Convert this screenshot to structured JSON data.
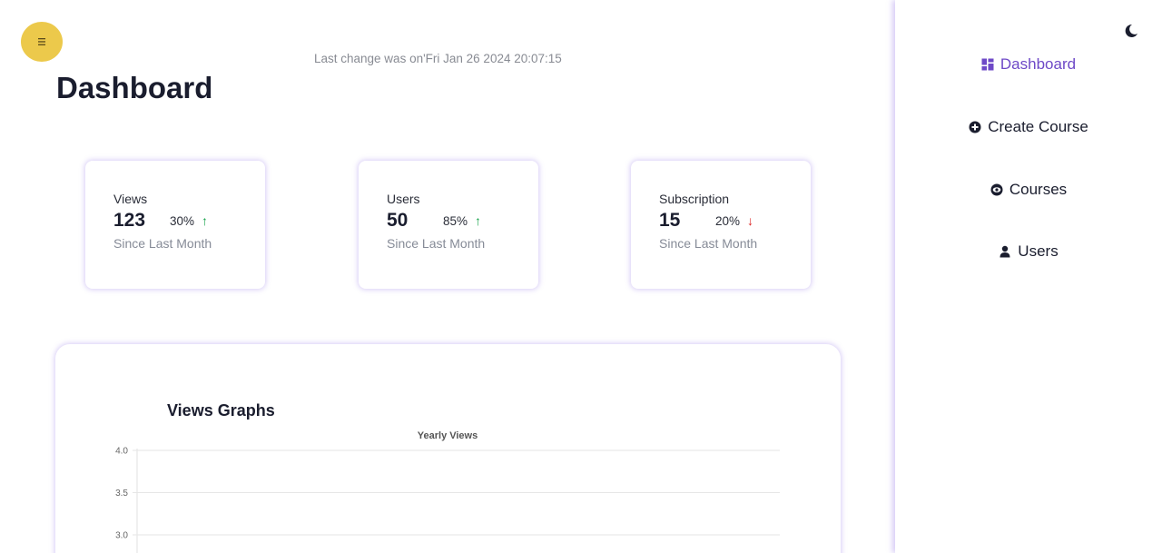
{
  "header": {
    "last_change": "Last change was on'Fri Jan 26 2024 20:07:15",
    "title": "Dashboard"
  },
  "menu_button": {
    "icon": "hamburger-menu-icon"
  },
  "stats": [
    {
      "label": "Views",
      "value": "123",
      "percent": "30%",
      "trend": "up",
      "since": "Since Last Month"
    },
    {
      "label": "Users",
      "value": "50",
      "percent": "85%",
      "trend": "up",
      "since": "Since Last Month"
    },
    {
      "label": "Subscription",
      "value": "15",
      "percent": "20%",
      "trend": "down",
      "since": "Since Last Month"
    }
  ],
  "graph": {
    "title": "Views Graphs"
  },
  "chart_data": {
    "type": "line",
    "title": "Yearly Views",
    "y_ticks": [
      "4.0",
      "3.5",
      "3.0"
    ],
    "ylim_visible": [
      3.0,
      4.0
    ],
    "series": [],
    "grid": true
  },
  "sidebar": {
    "theme_toggle_icon": "moon-icon",
    "items": [
      {
        "label": "Dashboard",
        "icon": "dashboard-grid-icon",
        "active": true
      },
      {
        "label": "Create Course",
        "icon": "plus-circle-icon",
        "active": false
      },
      {
        "label": "Courses",
        "icon": "eye-icon",
        "active": false
      },
      {
        "label": "Users",
        "icon": "user-icon",
        "active": false
      }
    ]
  },
  "colors": {
    "accent": "#6e49c7",
    "menu_button": "#ecc94b",
    "trend_up": "#16a34a",
    "trend_down": "#dc2626"
  }
}
